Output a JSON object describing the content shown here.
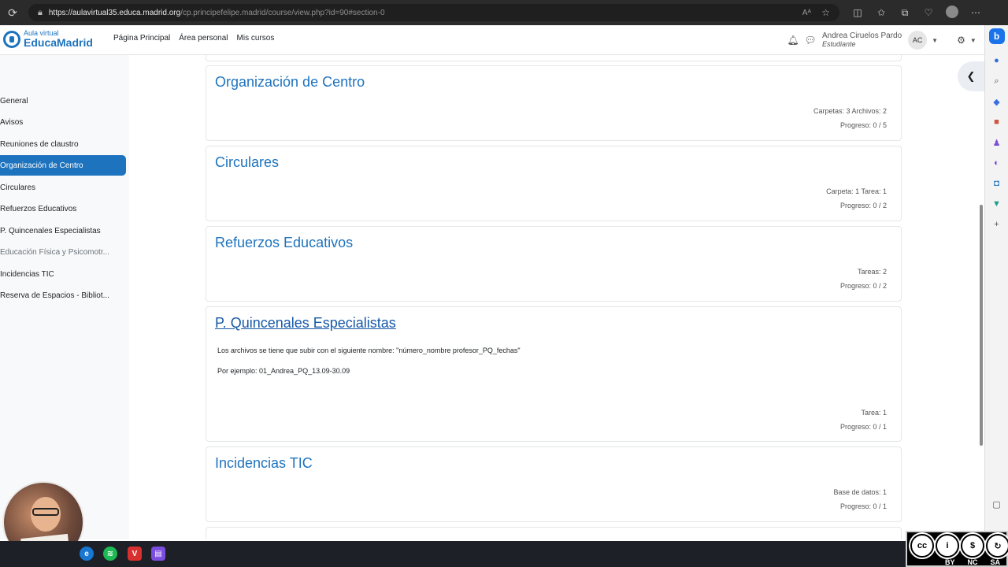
{
  "browser": {
    "url_main": "https://aulavirtual35.educa.madrid.org",
    "url_rest": "/cp.principefelipe.madrid/course/view.php?id=90#section-0",
    "reader_label": "Aᴬ"
  },
  "navbar": {
    "logo_small": "Aula virtual",
    "logo_big": "EducaMadrid",
    "links": [
      "Página Principal",
      "Área personal",
      "Mis cursos"
    ],
    "user_name": "Andrea Ciruelos Pardo",
    "user_role": "Estudiante",
    "avatar_initials": "AC"
  },
  "course_index": {
    "items": [
      {
        "label": "General",
        "state": "normal"
      },
      {
        "label": "Avisos",
        "state": "normal"
      },
      {
        "label": "Reuniones de claustro",
        "state": "normal"
      },
      {
        "label": "Organización de Centro",
        "state": "active"
      },
      {
        "label": "Circulares",
        "state": "normal"
      },
      {
        "label": "Refuerzos Educativos",
        "state": "normal"
      },
      {
        "label": "P. Quincenales Especialistas",
        "state": "normal"
      },
      {
        "label": "Educación Física y Psicomotr...",
        "state": "dim"
      },
      {
        "label": "Incidencias TIC",
        "state": "normal"
      },
      {
        "label": "Reserva de Espacios - Bibliot...",
        "state": "normal"
      }
    ]
  },
  "sections": [
    {
      "title": "Organización de Centro",
      "activities": "Carpetas: 3   Archivos: 2",
      "progress": "Progreso: 0 / 5"
    },
    {
      "title": "Circulares",
      "activities": "Carpeta: 1   Tarea: 1",
      "progress": "Progreso: 0 / 2"
    },
    {
      "title": "Refuerzos Educativos",
      "activities": "Tareas: 2",
      "progress": "Progreso: 0 / 2"
    },
    {
      "title": "P. Quincenales Especialistas",
      "summary_1": "Los archivos se tiene que subir con el siguiente nombre: \"número_nombre profesor_PQ_fechas\"",
      "summary_2": "Por ejemplo: 01_Andrea_PQ_13.09-30.09",
      "activities": "Tarea: 1",
      "progress": "Progreso: 0 / 1"
    },
    {
      "title": "Incidencias TIC",
      "activities": "Base de datos: 1",
      "progress": "Progreso: 0 / 1"
    }
  ],
  "license": {
    "labels": [
      "BY",
      "NC",
      "SA"
    ]
  },
  "colors": {
    "accent": "#1e73be",
    "active_bg": "#1e73be"
  }
}
